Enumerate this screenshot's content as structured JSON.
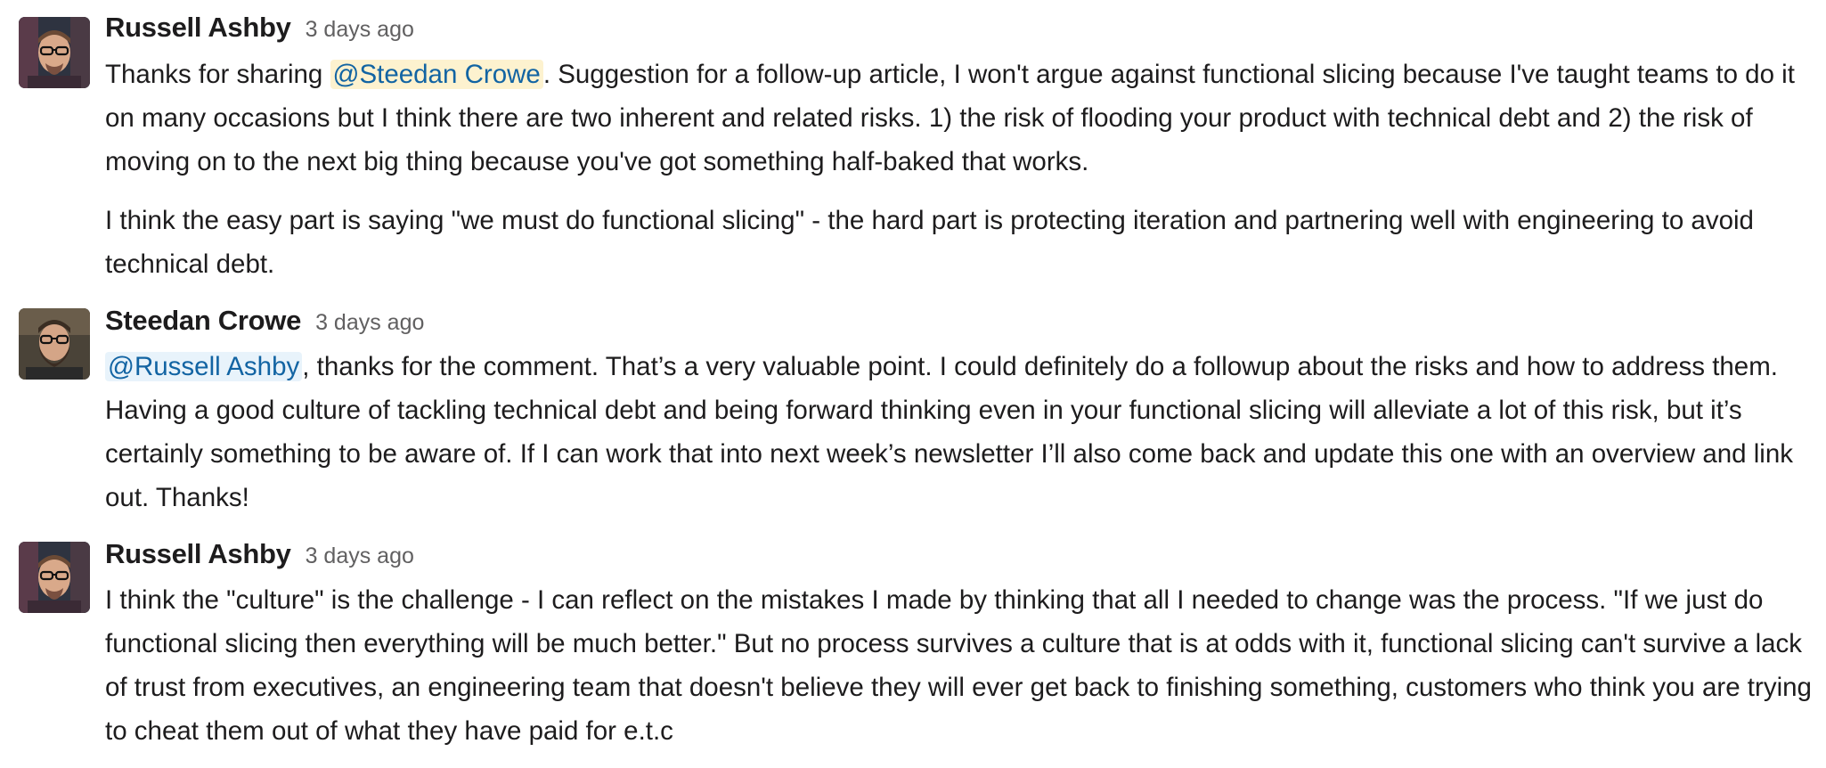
{
  "colors": {
    "author": "#1d1c1d",
    "timestamp": "#616061",
    "mention_text": "#1264a3",
    "mention_self_bg": "#fdf2cf",
    "mention_other_bg": "#e8f3fb"
  },
  "messages": [
    {
      "author": "Russell Ashby",
      "timestamp": "3 days ago",
      "avatar_icon": "russell-ashby-avatar",
      "paragraphs": [
        {
          "before": "Thanks for sharing ",
          "mention": "@Steedan Crowe",
          "after": ". Suggestion for a follow-up article, I won't argue against functional slicing because I've taught teams to do it on many occasions but I think there are two inherent and related risks. 1) the risk of flooding your product with technical debt and 2) the risk of moving on to the next big thing because you've got something half-baked that works."
        },
        {
          "text": "I think the easy part is saying \"we must do functional slicing\" - the hard part is protecting iteration and partnering well with engineering to avoid technical debt."
        }
      ]
    },
    {
      "author": "Steedan Crowe",
      "timestamp": "3 days ago",
      "avatar_icon": "steedan-crowe-avatar",
      "paragraphs": [
        {
          "mention": "@Russell Ashby",
          "after": ", thanks for the comment. That’s a very valuable point. I could definitely do a followup about the risks and how to address them. Having a good culture of tackling technical debt and being forward thinking even in your functional slicing will alleviate a lot of this risk, but it’s certainly something to be aware of. If I can work that into next week’s newsletter I’ll also come back and update this one with an overview and link out. Thanks!"
        }
      ]
    },
    {
      "author": "Russell Ashby",
      "timestamp": "3 days ago",
      "avatar_icon": "russell-ashby-avatar",
      "paragraphs": [
        {
          "text": "I think the \"culture\" is the challenge - I can reflect on the mistakes I made by thinking that all I needed to change was the process. \"If we just do functional slicing then everything will be much better.\" But no process survives a culture that is at odds with it, functional slicing can't survive a lack of trust from executives, an engineering team that doesn't believe they will ever get back to finishing something, customers who think you are trying to cheat them out of what they have paid for e.t.c"
        }
      ]
    }
  ]
}
